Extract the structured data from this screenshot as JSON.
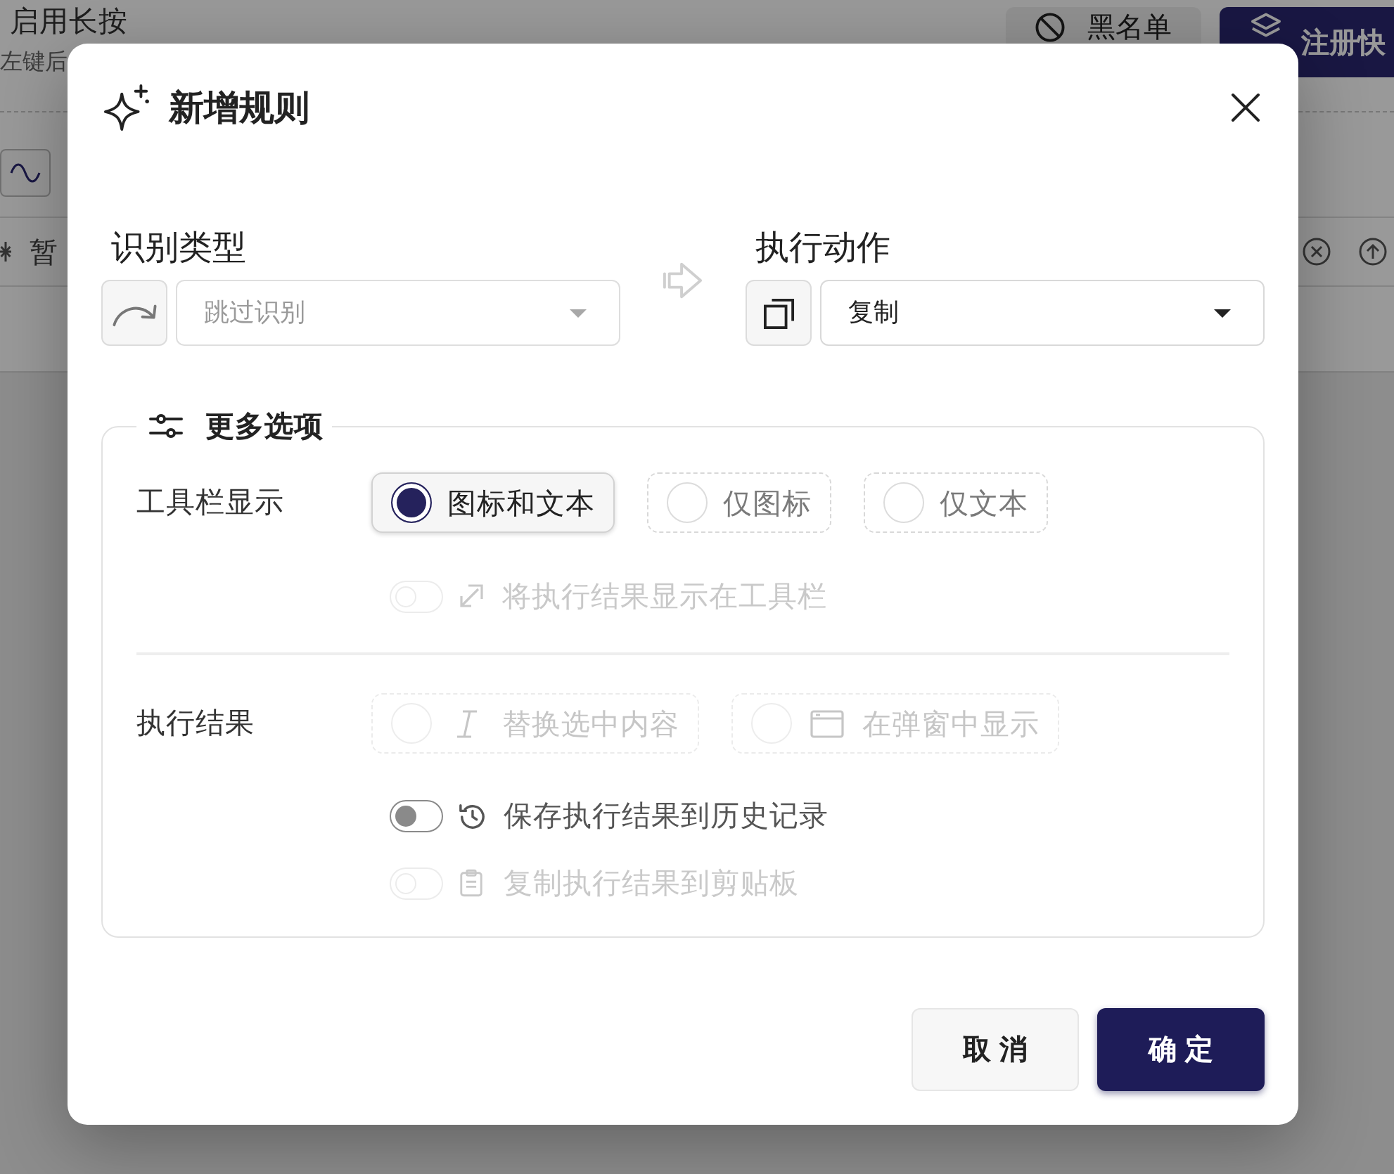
{
  "background": {
    "setting": {
      "label": "启用长按",
      "hint": "左键后"
    },
    "buttons": [
      {
        "label": "黑名单",
        "kind": "outline"
      },
      {
        "label": "注册快",
        "kind": "primary"
      }
    ],
    "list_row": {
      "text": "暂"
    }
  },
  "dialog": {
    "title": "新增规则",
    "recognition": {
      "label": "识别类型",
      "value": "跳过识别",
      "disabled": true
    },
    "action": {
      "label": "执行动作",
      "value": "复制",
      "disabled": false
    },
    "more_options": {
      "title": "更多选项",
      "toolbar_display": {
        "label": "工具栏显示",
        "options": [
          {
            "label": "图标和文本",
            "selected": true,
            "disabled": false
          },
          {
            "label": "仅图标",
            "selected": false,
            "disabled": false
          },
          {
            "label": "仅文本",
            "selected": false,
            "disabled": false
          }
        ],
        "toggles": [
          {
            "label": "将执行结果显示在工具栏",
            "on": false,
            "disabled": true
          }
        ]
      },
      "result": {
        "label": "执行结果",
        "options": [
          {
            "label": "替换选中内容",
            "selected": false,
            "disabled": true
          },
          {
            "label": "在弹窗中显示",
            "selected": false,
            "disabled": true
          }
        ],
        "toggles": [
          {
            "label": "保存执行结果到历史记录",
            "on": false,
            "disabled": false
          },
          {
            "label": "复制执行结果到剪贴板",
            "on": false,
            "disabled": true
          }
        ]
      }
    },
    "buttons": [
      {
        "label": "取消",
        "kind": "secondary"
      },
      {
        "label": "确定",
        "kind": "primary"
      }
    ]
  }
}
